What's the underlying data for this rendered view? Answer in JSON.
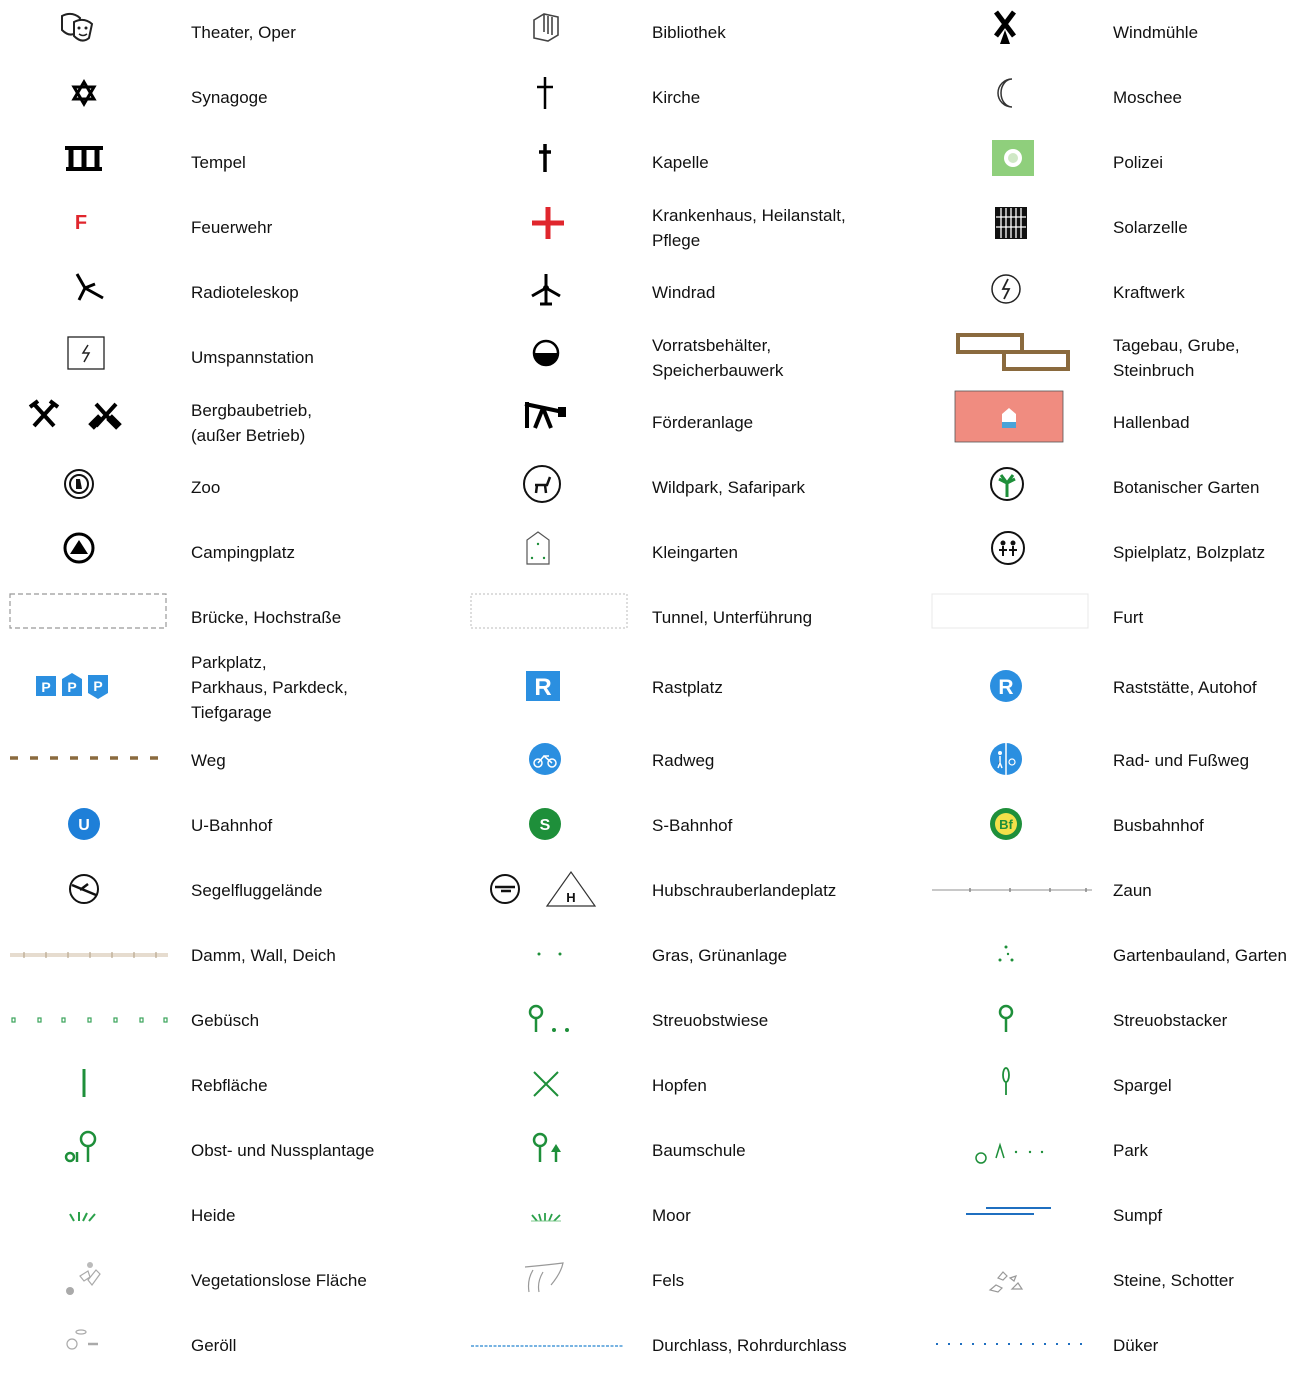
{
  "legend": {
    "rows": [
      [
        {
          "label": "Theater, Oper",
          "icon": "theater-masks-icon"
        },
        {
          "label": "Bibliothek",
          "icon": "library-books-icon"
        },
        {
          "label": "Windmühle",
          "icon": "windmill-icon"
        }
      ],
      [
        {
          "label": "Synagoge",
          "icon": "star-of-david-icon"
        },
        {
          "label": "Kirche",
          "icon": "cross-icon"
        },
        {
          "label": "Moschee",
          "icon": "crescent-icon"
        }
      ],
      [
        {
          "label": "Tempel",
          "icon": "temple-icon"
        },
        {
          "label": "Kapelle",
          "icon": "chapel-cross-icon"
        },
        {
          "label": "Polizei",
          "icon": "police-icon"
        }
      ],
      [
        {
          "label": "Feuerwehr",
          "icon": "fire-station-icon"
        },
        {
          "label": "Krankenhaus, Heilanstalt,\nPflege",
          "icon": "hospital-cross-icon"
        },
        {
          "label": "Solarzelle",
          "icon": "solar-panel-icon"
        }
      ],
      [
        {
          "label": "Radioteleskop",
          "icon": "radio-telescope-icon"
        },
        {
          "label": "Windrad",
          "icon": "wind-turbine-icon"
        },
        {
          "label": "Kraftwerk",
          "icon": "power-plant-icon"
        }
      ],
      [
        {
          "label": "Umspannstation",
          "icon": "substation-icon"
        },
        {
          "label": "Vorratsbehälter,\nSpeicherbauwerk",
          "icon": "storage-tank-icon"
        },
        {
          "label": "Tagebau, Grube,\nSteinbruch",
          "icon": "quarry-icon"
        }
      ],
      [
        {
          "label": "Bergbaubetrieb,\n(außer Betrieb)",
          "icon": "mining-hammers-icon"
        },
        {
          "label": "Förderanlage",
          "icon": "pumpjack-icon"
        },
        {
          "label": "Hallenbad",
          "icon": "indoor-pool-icon"
        }
      ],
      [
        {
          "label": "Zoo",
          "icon": "zoo-icon"
        },
        {
          "label": "Wildpark, Safaripark",
          "icon": "wildlife-park-icon"
        },
        {
          "label": "Botanischer Garten",
          "icon": "botanical-garden-icon"
        }
      ],
      [
        {
          "label": "Campingplatz",
          "icon": "camping-icon"
        },
        {
          "label": "Kleingarten",
          "icon": "allotment-icon"
        },
        {
          "label": "Spielplatz, Bolzplatz",
          "icon": "playground-icon"
        }
      ],
      [
        {
          "label": "Brücke, Hochstraße",
          "icon": "bridge-outline-icon"
        },
        {
          "label": "Tunnel, Unterführung",
          "icon": "tunnel-outline-icon"
        },
        {
          "label": "Furt",
          "icon": "ford-outline-icon"
        }
      ],
      [
        {
          "label": "Parkplatz,\nParkhaus, Parkdeck,\nTiefgarage",
          "icon": "parking-icons",
          "text": [
            "P",
            "P",
            "P"
          ]
        },
        {
          "label": "Rastplatz",
          "icon": "rest-area-icon",
          "text": "R"
        },
        {
          "label": "Raststätte, Autohof",
          "icon": "service-area-icon",
          "text": "R"
        }
      ],
      [
        {
          "label": "Weg",
          "icon": "path-line-icon"
        },
        {
          "label": "Radweg",
          "icon": "cycleway-icon"
        },
        {
          "label": "Rad- und Fußweg",
          "icon": "cycle-footway-icon"
        }
      ],
      [
        {
          "label": "U-Bahnhof",
          "icon": "subway-station-icon",
          "text": "U"
        },
        {
          "label": "S-Bahnhof",
          "icon": "suburban-rail-icon",
          "text": "S"
        },
        {
          "label": "Busbahnhof",
          "icon": "bus-station-icon",
          "text": "Bf"
        }
      ],
      [
        {
          "label": "Segelfluggelände",
          "icon": "glider-field-icon"
        },
        {
          "label": "Hubschrauberlandeplatz",
          "icon": "heliport-icon",
          "text": "H"
        },
        {
          "label": "Zaun",
          "icon": "fence-line-icon"
        }
      ],
      [
        {
          "label": "Damm, Wall, Deich",
          "icon": "dam-line-icon"
        },
        {
          "label": "Gras, Grünanlage",
          "icon": "grass-dots-icon"
        },
        {
          "label": "Gartenbauland, Garten",
          "icon": "horticulture-dots-icon"
        }
      ],
      [
        {
          "label": "Gebüsch",
          "icon": "shrubs-pattern-icon"
        },
        {
          "label": "Streuobstwiese",
          "icon": "orchard-meadow-icon"
        },
        {
          "label": "Streuobstacker",
          "icon": "orchard-field-icon"
        }
      ],
      [
        {
          "label": "Rebfläche",
          "icon": "vineyard-icon"
        },
        {
          "label": "Hopfen",
          "icon": "hops-icon"
        },
        {
          "label": "Spargel",
          "icon": "asparagus-icon"
        }
      ],
      [
        {
          "label": "Obst- und Nussplantage",
          "icon": "fruit-plantation-icon"
        },
        {
          "label": "Baumschule",
          "icon": "tree-nursery-icon"
        },
        {
          "label": "Park",
          "icon": "park-icon"
        }
      ],
      [
        {
          "label": "Heide",
          "icon": "heath-icon"
        },
        {
          "label": "Moor",
          "icon": "moor-icon"
        },
        {
          "label": "Sumpf",
          "icon": "swamp-icon"
        }
      ],
      [
        {
          "label": "Vegetationslose Fläche",
          "icon": "bare-ground-icon"
        },
        {
          "label": "Fels",
          "icon": "rock-icon"
        },
        {
          "label": "Steine, Schotter",
          "icon": "stones-icon"
        }
      ],
      [
        {
          "label": "Geröll",
          "icon": "scree-icon"
        },
        {
          "label": "Durchlass, Rohrdurchlass",
          "icon": "culvert-line-icon"
        },
        {
          "label": "Düker",
          "icon": "siphon-line-icon"
        }
      ]
    ]
  },
  "colors": {
    "text": "#111111",
    "fire_red": "#e0262d",
    "blue": "#2b8fe0",
    "green": "#1e8f3a",
    "brown": "#8a6a3e",
    "gray": "#9a9a9a",
    "pool_bg": "#f08c80",
    "police_bg": "#8fcf7c"
  }
}
